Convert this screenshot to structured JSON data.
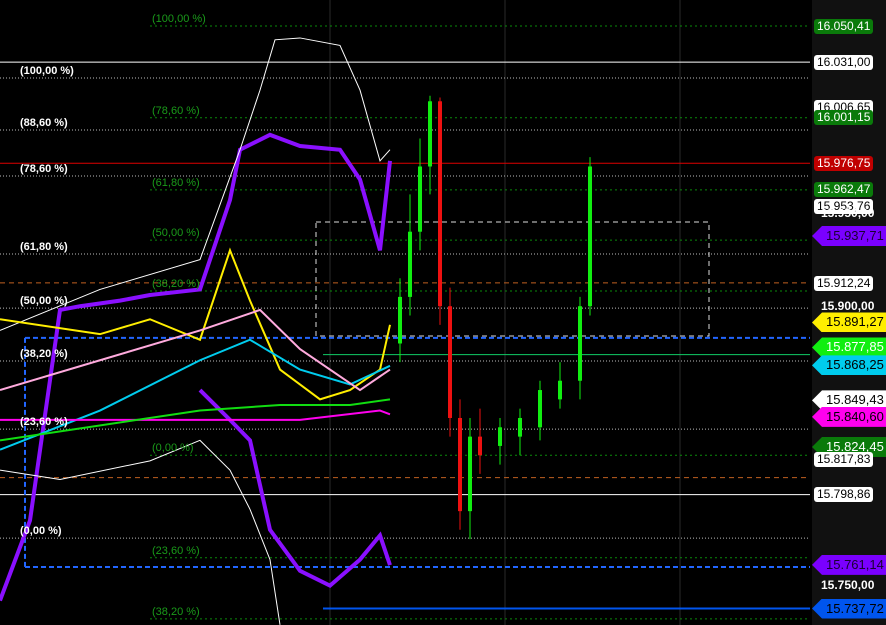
{
  "chart_data": {
    "type": "line",
    "title": "",
    "ylim": [
      15729,
      16062
    ],
    "price_labels": [
      {
        "text": "16.050,41",
        "price": 16050.41,
        "bg": "#0a7a0a",
        "fg": "#ffffff",
        "style": "box"
      },
      {
        "text": "16.031,00",
        "price": 16031.0,
        "bg": "#ffffff",
        "fg": "#000000",
        "style": "box"
      },
      {
        "text": "16.006,65",
        "price": 16006.65,
        "bg": "#ffffff",
        "fg": "#000000",
        "style": "box"
      },
      {
        "text": "16.001,15",
        "price": 16001.15,
        "bg": "#0a7a0a",
        "fg": "#ffffff",
        "style": "box"
      },
      {
        "text": "15.976,75",
        "price": 15976.75,
        "bg": "#c00000",
        "fg": "#ffffff",
        "style": "box"
      },
      {
        "text": "15.962,47",
        "price": 15962.47,
        "bg": "#0a7a0a",
        "fg": "#ffffff",
        "style": "box"
      },
      {
        "text": "15.953,76",
        "price": 15953.76,
        "bg": "#ffffff",
        "fg": "#000000",
        "style": "box"
      },
      {
        "text": "15.950,00",
        "price": 15950.0,
        "bg": "",
        "fg": "#ffffff",
        "style": "plain"
      },
      {
        "text": "15.937,71",
        "price": 15937.71,
        "bg": "#7a00ff",
        "fg": "#1a0033",
        "style": "arrow"
      },
      {
        "text": "15.912,24",
        "price": 15912.24,
        "bg": "#ffffff",
        "fg": "#000000",
        "style": "box"
      },
      {
        "text": "15.900,00",
        "price": 15900.0,
        "bg": "",
        "fg": "#ffffff",
        "style": "plain"
      },
      {
        "text": "15.891,27",
        "price": 15891.27,
        "bg": "#ffee00",
        "fg": "#000000",
        "style": "arrow"
      },
      {
        "text": "15.877,85",
        "price": 15877.85,
        "bg": "#11ee11",
        "fg": "#ffffff",
        "style": "arrow"
      },
      {
        "text": "15.868,25",
        "price": 15868.25,
        "bg": "#00ccee",
        "fg": "#000000",
        "style": "arrow"
      },
      {
        "text": "15.849,43",
        "price": 15849.43,
        "bg": "#ffffff",
        "fg": "#000000",
        "style": "arrow"
      },
      {
        "text": "15.840,60",
        "price": 15840.6,
        "bg": "#ff00ee",
        "fg": "#000000",
        "style": "arrow"
      },
      {
        "text": "15.824,45",
        "price": 15824.45,
        "bg": "#0a7a0a",
        "fg": "#ffffff",
        "style": "arrow"
      },
      {
        "text": "15.817,83",
        "price": 15817.83,
        "bg": "#ffffff",
        "fg": "#000000",
        "style": "box"
      },
      {
        "text": "15.798,86",
        "price": 15798.86,
        "bg": "#ffffff",
        "fg": "#000000",
        "style": "box"
      },
      {
        "text": "15.761,14",
        "price": 15761.14,
        "bg": "#7a00ff",
        "fg": "#1a0033",
        "style": "arrow"
      },
      {
        "text": "15.750,00",
        "price": 15750.0,
        "bg": "",
        "fg": "#ffffff",
        "style": "plain"
      },
      {
        "text": "15.737,72",
        "price": 15737.72,
        "bg": "#0055ee",
        "fg": "#000000",
        "style": "arrow"
      }
    ],
    "fib_white": [
      {
        "text": "(100,00 %)",
        "price": 16022.5
      },
      {
        "text": "(88,60 %)",
        "price": 15994.6
      },
      {
        "text": "(78,60 %)",
        "price": 15969.9
      },
      {
        "text": "(61,80 %)",
        "price": 15928
      },
      {
        "text": "(50,00 %)",
        "price": 15899
      },
      {
        "text": "(38,20 %)",
        "price": 15870.6
      },
      {
        "text": "(23,60 %)",
        "price": 15834
      },
      {
        "text": "(0,00 %)",
        "price": 15775.5
      }
    ],
    "fib_green": [
      {
        "text": "(100,00 %)",
        "price": 16050.41
      },
      {
        "text": "(78,60 %)",
        "price": 16001.15
      },
      {
        "text": "(61,80 %)",
        "price": 15962.47
      },
      {
        "text": "(50,00 %)",
        "price": 15935.5
      },
      {
        "text": "(38,20 %)",
        "price": 15908.14
      },
      {
        "text": "(0,00 %)",
        "price": 15820
      },
      {
        "text": "(23,60 %)",
        "price": 15765
      },
      {
        "text": "(38,20 %)",
        "price": 15732.2
      }
    ],
    "series": [
      {
        "name": "purple-upper",
        "color": "#8a10ff",
        "width": 4,
        "x": [
          0,
          3,
          6,
          8,
          12,
          15,
          20,
          23,
          24,
          27,
          30,
          34,
          36,
          38,
          39
        ],
        "y": [
          15742,
          15785,
          15898,
          15900,
          15903,
          15906,
          15909,
          15957,
          15984,
          15992,
          15986,
          15984,
          15968,
          15930,
          15978
        ]
      },
      {
        "name": "purple-lower",
        "color": "#8a10ff",
        "width": 4,
        "x": [
          20,
          23,
          25,
          27,
          30,
          33,
          36,
          38,
          39
        ],
        "y": [
          15855,
          15839,
          15828,
          15780,
          15758,
          15750,
          15764,
          15777,
          15761
        ]
      },
      {
        "name": "envelope-upper",
        "color": "#ffffff",
        "width": 1,
        "x": [
          0,
          10,
          20,
          24,
          26,
          27.5,
          30,
          34,
          36,
          38,
          39
        ],
        "y": [
          15887,
          15909,
          15925,
          15984,
          16016,
          16043,
          16044,
          16040,
          16016,
          15978,
          15984
        ]
      },
      {
        "name": "envelope-lower",
        "color": "#ffffff",
        "width": 1,
        "x": [
          0,
          6,
          15,
          20,
          23,
          25,
          27,
          28
        ],
        "y": [
          15812,
          15807,
          15817,
          15828,
          15812,
          15791,
          15764,
          15729
        ]
      },
      {
        "name": "yellow",
        "color": "#ffee00",
        "width": 2,
        "x": [
          0,
          10,
          15,
          20,
          23,
          25,
          28,
          32,
          35,
          38,
          39
        ],
        "y": [
          15893,
          15885,
          15893,
          15882,
          15930,
          15903,
          15866,
          15850,
          15855,
          15866,
          15890
        ]
      },
      {
        "name": "cyan",
        "color": "#00ccee",
        "width": 2,
        "x": [
          0,
          10,
          20,
          25,
          30,
          35,
          39
        ],
        "y": [
          15823,
          15844,
          15871,
          15882,
          15866,
          15858,
          15868
        ]
      },
      {
        "name": "magenta",
        "color": "#ff00ee",
        "width": 2,
        "x": [
          0,
          20,
          30,
          38,
          39
        ],
        "y": [
          15839,
          15839,
          15839,
          15844,
          15842
        ]
      },
      {
        "name": "green-ma",
        "color": "#11dd11",
        "width": 2,
        "x": [
          0,
          20,
          28,
          35,
          39
        ],
        "y": [
          15828,
          15844,
          15847,
          15847,
          15850
        ]
      },
      {
        "name": "pink",
        "color": "#ffaadd",
        "width": 2,
        "x": [
          0,
          10,
          20,
          26,
          30,
          36,
          39
        ],
        "y": [
          15855,
          15871,
          15887,
          15898,
          15877,
          15855,
          15866
        ]
      }
    ],
    "candles": [
      {
        "x": 20,
        "o": 15880,
        "c": 15905,
        "h": 15915,
        "l": 15870
      },
      {
        "x": 21,
        "o": 15905,
        "c": 15940,
        "h": 15960,
        "l": 15895
      },
      {
        "x": 22,
        "o": 15940,
        "c": 15975,
        "h": 15990,
        "l": 15930
      },
      {
        "x": 23,
        "o": 15975,
        "c": 16010,
        "h": 16013,
        "l": 15960
      },
      {
        "x": 24,
        "o": 16010,
        "c": 15900,
        "h": 16012,
        "l": 15890
      },
      {
        "x": 25,
        "o": 15900,
        "c": 15840,
        "h": 15910,
        "l": 15830
      },
      {
        "x": 26,
        "o": 15840,
        "c": 15790,
        "h": 15850,
        "l": 15780
      },
      {
        "x": 27,
        "o": 15790,
        "c": 15830,
        "h": 15840,
        "l": 15775
      },
      {
        "x": 28,
        "o": 15830,
        "c": 15820,
        "h": 15845,
        "l": 15810
      },
      {
        "x": 30,
        "o": 15825,
        "c": 15835,
        "h": 15840,
        "l": 15815
      },
      {
        "x": 32,
        "o": 15830,
        "c": 15840,
        "h": 15845,
        "l": 15820
      },
      {
        "x": 34,
        "o": 15835,
        "c": 15855,
        "h": 15860,
        "l": 15828
      },
      {
        "x": 36,
        "o": 15850,
        "c": 15860,
        "h": 15870,
        "l": 15845
      },
      {
        "x": 38,
        "o": 15860,
        "c": 15900,
        "h": 15905,
        "l": 15850
      },
      {
        "x": 39,
        "o": 15900,
        "c": 15975,
        "h": 15980,
        "l": 15895
      }
    ]
  }
}
